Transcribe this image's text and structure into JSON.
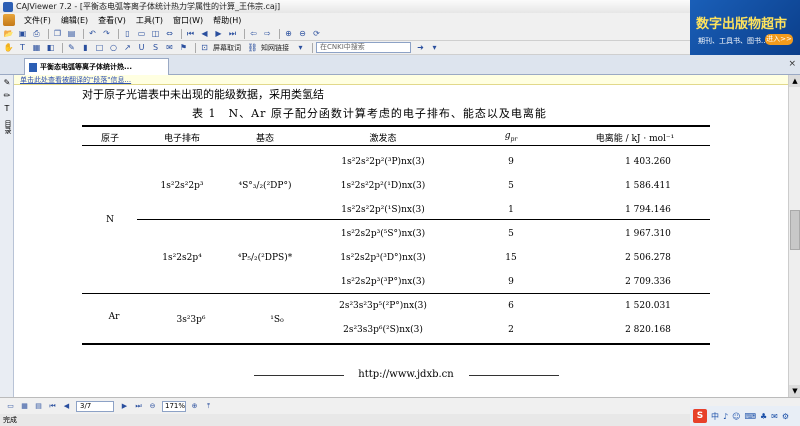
{
  "window": {
    "title": "CAJViewer 7.2 - [平衡态电弧等离子体统计热力学属性的计算_王伟宗.caj]",
    "controls": [
      "_",
      "□",
      "×"
    ]
  },
  "menu": [
    "文件(F)",
    "编辑(E)",
    "查看(V)",
    "工具(T)",
    "窗口(W)",
    "帮助(H)"
  ],
  "toolbar2": {
    "screen_capture_label": "屏幕取词",
    "knowledge_link_label": "知网链接",
    "cnki_search_placeholder": "在CNKI中搜索"
  },
  "ad": {
    "title": "数字出版物超市",
    "subtitle": "期刊、工具书、图书...",
    "enter_label": "进入>>"
  },
  "tab": {
    "label": "平衡态电弧等离子体统计热..."
  },
  "sidebar": {
    "label": "目录"
  },
  "notice": "单击此处查看被翻译的\"段落\"信息...",
  "document": {
    "intro": "对于原子光谱表中未出现的能级数据，采用类氢结",
    "caption": "表 1　N、Ar 原子配分函数计算考虑的电子排布、能态以及电离能",
    "headers": {
      "atom": "原子",
      "config": "电子排布",
      "ground": "基态",
      "excited": "激发态",
      "g": "g",
      "g_sub": "pr",
      "ionization": "电离能 / kJ · mol⁻¹"
    },
    "rows": [
      {
        "atom": "",
        "config": "1s²2s²2p³",
        "ground": "⁴S°₃/₂(²DP°)",
        "excited": "1s²2s²2p²(³P)nx(3)",
        "g": "9",
        "energy": "1 403.260"
      },
      {
        "atom": "",
        "config": "",
        "ground": "",
        "excited": "1s²2s²2p²(¹D)nx(3)",
        "g": "5",
        "energy": "1 586.411"
      },
      {
        "atom": "N",
        "config": "",
        "ground": "",
        "excited": "1s²2s²2p²(¹S)nx(3)",
        "g": "1",
        "energy": "1 794.146"
      },
      {
        "atom": "",
        "config": "1s²2s2p⁴",
        "ground": "⁴P₅/₂(²DPS)*",
        "excited": "1s²2s2p³(⁵S°)nx(3)",
        "g": "5",
        "energy": "1 967.310"
      },
      {
        "atom": "",
        "config": "",
        "ground": "",
        "excited": "1s²2s2p³(³D°)nx(3)",
        "g": "15",
        "energy": "2 506.278"
      },
      {
        "atom": "",
        "config": "",
        "ground": "",
        "excited": "1s²2s2p³(³P°)nx(3)",
        "g": "9",
        "energy": "2 709.336"
      },
      {
        "atom": "Ar",
        "config": "3s²3p⁶",
        "ground": "¹S₀",
        "excited": "2s²3s²3p⁵(²P°)nx(3)",
        "g": "6",
        "energy": "1 520.031"
      },
      {
        "atom": "",
        "config": "",
        "ground": "",
        "excited": "2s²3s3p⁶(²S)nx(3)",
        "g": "2",
        "energy": "2 820.168"
      }
    ],
    "footer_url": "http://www.jdxb.cn"
  },
  "navigation": {
    "page": "3/7",
    "zoom": "171%"
  },
  "status": "完成",
  "tray": {
    "ime_icon": "S",
    "items": [
      "中",
      "♪",
      "☺",
      "⌨",
      "♣",
      "✉",
      "⚙"
    ]
  }
}
